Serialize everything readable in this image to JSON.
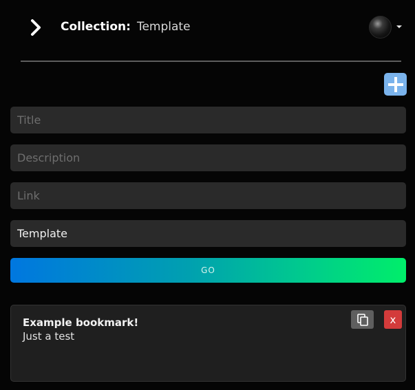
{
  "header": {
    "menu_icon": "chevron-right-icon",
    "collection_label": "Collection:",
    "collection_name": "Template",
    "profile_icon": "avatar",
    "dropdown_icon": "caret-down-icon"
  },
  "toolbar": {
    "add_icon": "plus-icon"
  },
  "form": {
    "title_placeholder": "Title",
    "description_placeholder": "Description",
    "link_placeholder": "Link",
    "collection_value": "Template",
    "submit_label": "GO"
  },
  "bookmarks": [
    {
      "title": "Example bookmark!",
      "description": "Just a test",
      "copy_icon": "copy-icon",
      "delete_label": "x"
    }
  ],
  "colors": {
    "background": "#050505",
    "input_bg": "#2a2a2a",
    "add_button": "#7ab3ec",
    "gradient_start": "#0077e0",
    "gradient_end": "#00ee6a",
    "delete_button": "#d33b3b",
    "copy_button": "#5f5f5f"
  }
}
